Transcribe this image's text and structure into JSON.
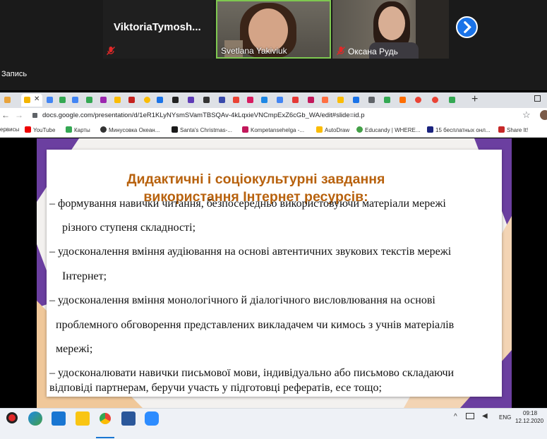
{
  "zoom": {
    "participants": [
      {
        "name": "ViktoriaTymosh...",
        "muted": true,
        "video": false
      },
      {
        "name": "Svetlana Yakiviuk",
        "muted": false,
        "video": true,
        "active": true
      },
      {
        "name": "Оксана Рудь",
        "muted": true,
        "video": true
      }
    ],
    "recording_label": "Запись"
  },
  "browser": {
    "url": "docs.google.com/presentation/d/1eR1KLyNYsmSVamTBSQAv-4kLqxieVNCmpExZ6cGb_WA/edit#slide=id.p",
    "bookmarks": [
      "ервисы",
      "YouTube",
      "Карты",
      "Минусовка Океан...",
      "Santa's Christmas-...",
      "Kompetansehelga -...",
      "AutoDraw",
      "Educandy | WHERE...",
      "15 бесплатных онл...",
      "Share It!"
    ]
  },
  "slide": {
    "title_line1": "Дидактичні  і соціокультурні завдання",
    "title_line2": "використання Інтернет ресурсів:",
    "lines": [
      "– формування навички читання, безпосередньо використовуючи матеріали мережі",
      "різного ступеня складності;",
      "– удосконалення вміння аудіювання на основі автентичних звукових текстів мережі",
      "Інтернет;",
      "– удосконалення вміння монологічного й діалогічного висловлювання на основі",
      "проблемного обговорення представлених викладачем чи кимось з учнів матеріалів",
      "мережі;",
      "–  удосконалювати  навички  письмової  мови,  індивідуально  або  письмово  складаючи",
      "відповіді партнерам, беручи участь у підготовці рефератів, есе тощо;"
    ]
  },
  "taskbar": {
    "language": "ENG",
    "time": "09:18",
    "date": "12.12.2020"
  },
  "colors": {
    "title_orange": "#b8620e",
    "purple_accent": "#6b3fa0",
    "peach_accent": "#f0c89a",
    "active_speaker_border": "#7ec850",
    "next_button": "#1a73e8"
  }
}
